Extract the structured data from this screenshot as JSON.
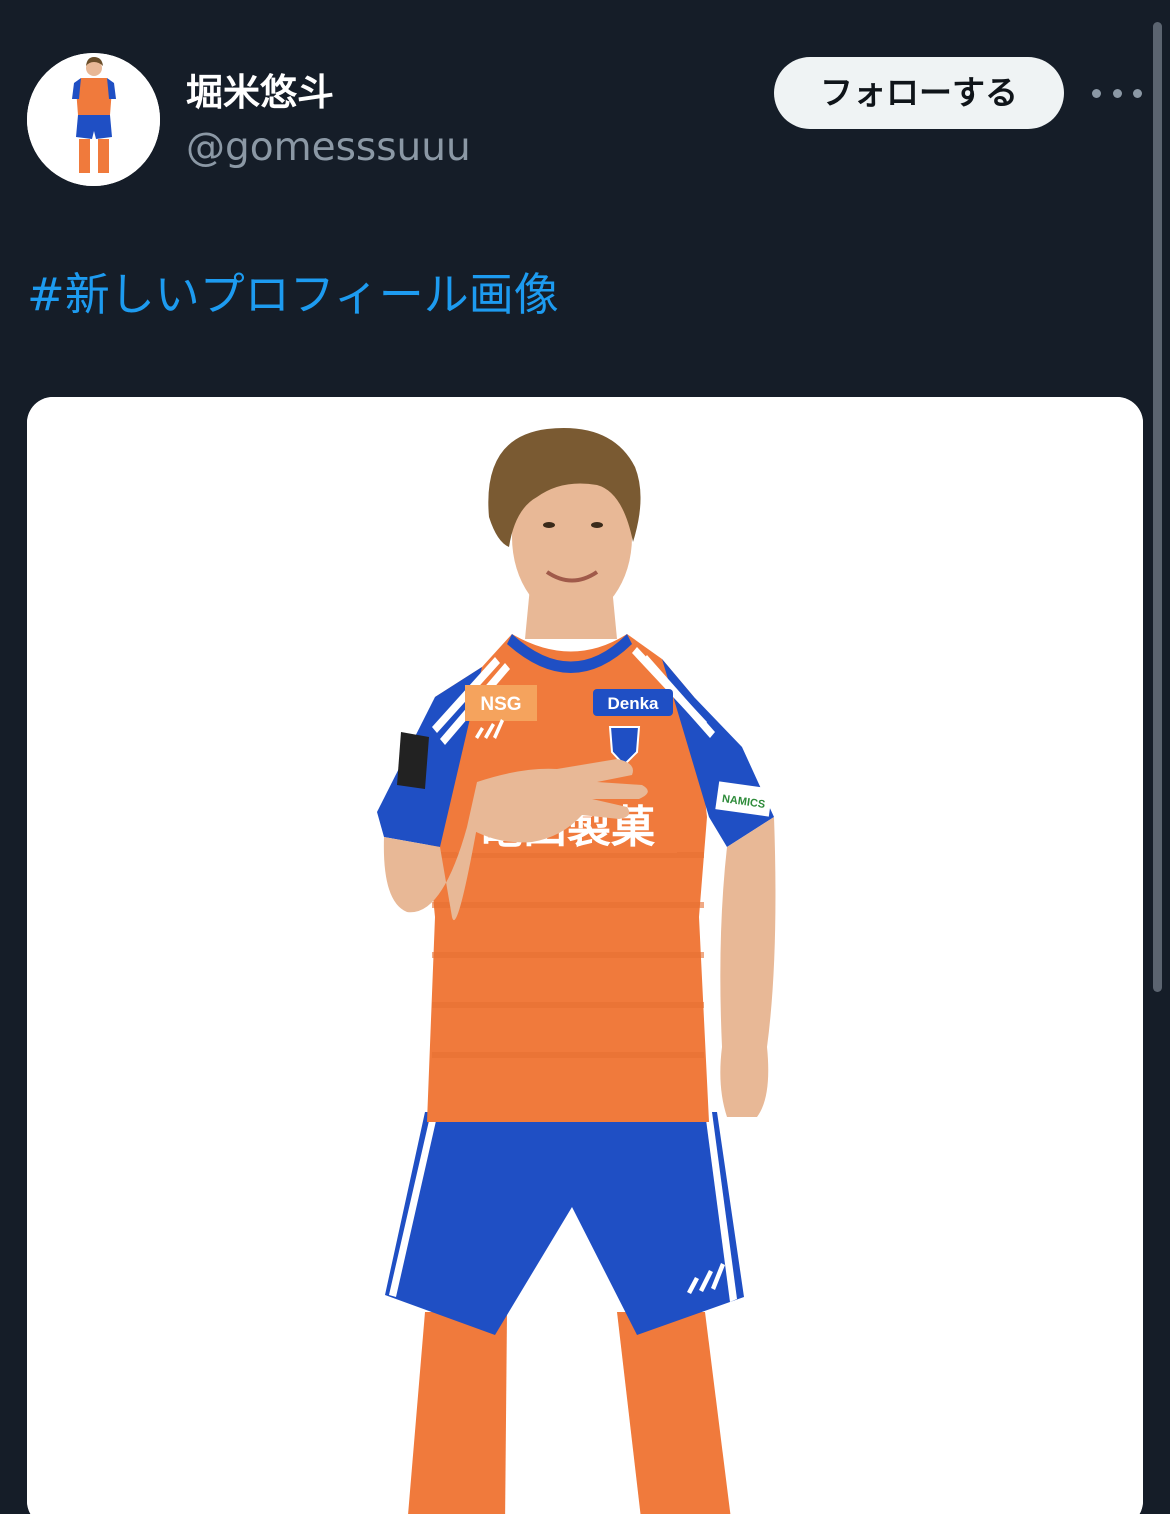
{
  "tweet": {
    "display_name": "堀米悠斗",
    "handle": "@gomesssuuu",
    "follow_label": "フォローする",
    "hashtag": "#新しいプロフィール画像"
  },
  "photo": {
    "chest_sponsor_1": "NSG",
    "chest_sponsor_2": "Denka",
    "front_sponsor": "亀田製菓",
    "sleeve_sponsor": "NAMICS"
  },
  "colors": {
    "background": "#151d28",
    "accent": "#1d9bf0",
    "secondary_text": "#8b98a5",
    "jersey_orange": "#f07a3c",
    "jersey_blue": "#1f4fc4"
  },
  "icons": {
    "more": "more-horizontal-icon"
  }
}
